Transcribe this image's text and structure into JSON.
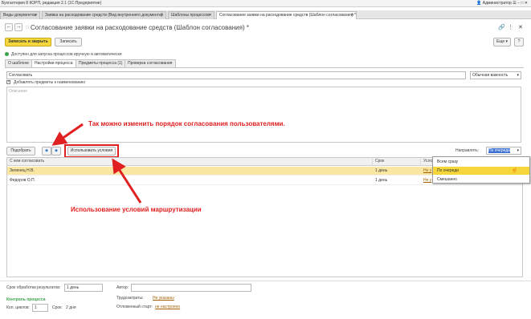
{
  "window": {
    "title": "Бухгалтерия 8 КОРП, редакция 2.1   (1С:Предприятие)",
    "user": "Администратор"
  },
  "tabs": [
    {
      "label": "Виды документов"
    },
    {
      "label": "Заявка на расходование средств (Вид внутреннего документа)"
    },
    {
      "label": "Шаблоны процессов"
    },
    {
      "label": "Согласование заявки на расходование средств (Шаблон согласования) *"
    }
  ],
  "header": {
    "title": "Согласование заявки на расходование средств (Шаблон согласования) *",
    "more_label": "Еще",
    "help_label": "?"
  },
  "toolbar": {
    "save_close_label": "Записать и закрыть",
    "save_label": "Записать"
  },
  "status": {
    "text": "Доступен для запуска процессов вручную и автоматически"
  },
  "process_tabs": [
    {
      "label": "О шаблоне"
    },
    {
      "label": "Настройки процесса"
    },
    {
      "label": "Предметы процесса (1)"
    },
    {
      "label": "Проверка согласования"
    }
  ],
  "form": {
    "name_value": "Согласовать",
    "importance_value": "Обычная важность",
    "add_subjects_label": "Добавлять предметы к наименованию",
    "description_placeholder": "Описание"
  },
  "grid_toolbar": {
    "pick_label": "Подобрать",
    "conditions_label": "Использовать условия",
    "direction_label": "Направлять:",
    "direction_value": "По очереди"
  },
  "grid": {
    "columns": [
      "С кем согласовать",
      "Срок",
      "Усло"
    ],
    "rows": [
      {
        "who": "Зеленец Н.В.",
        "term": "1 день",
        "cond": "Не у"
      },
      {
        "who": "Федоров О.П.",
        "term": "1 день",
        "cond": "Не у"
      }
    ]
  },
  "direction_options": [
    "Всем сразу",
    "По очереди",
    "Смешанно"
  ],
  "annotations": {
    "order": "Так можно изменить порядок согласования пользователями.",
    "routing": "Использование условий маршрутизации"
  },
  "bottom": {
    "processing_label": "Срок обработки результатов:",
    "processing_value": "1 день",
    "author_label": "Автор:",
    "labor_label": "Трудозатраты:",
    "labor_value": "Не указаны",
    "deferred_label": "Отложенный старт:",
    "deferred_value": "не настроено",
    "control_label": "Контроль процесса",
    "cycles_label": "Кол. циклов:",
    "cycles_value": "1",
    "term_label": "Срок:",
    "term_value": "2 дня"
  },
  "colors": {
    "accent": "#f5d63b",
    "annotation": "#e02020",
    "status_ok": "#3aa34a"
  }
}
